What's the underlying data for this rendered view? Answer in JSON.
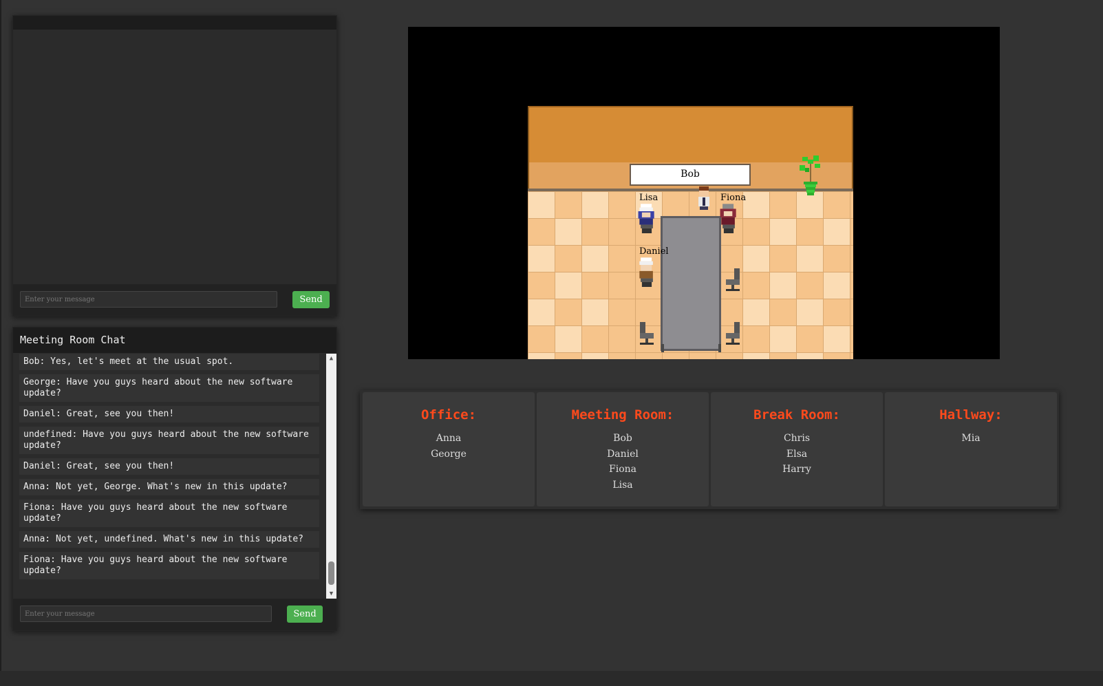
{
  "top_chat": {
    "title": "",
    "input_placeholder": "Enter your message",
    "send_label": "Send"
  },
  "meeting_chat": {
    "title": "Meeting Room Chat",
    "input_placeholder": "Enter your message",
    "send_label": "Send",
    "messages": [
      "Bob: Yes, let's meet at the usual spot.",
      "George: Have you guys heard about the new software update?",
      "Daniel: Great, see you then!",
      "undefined: Have you guys heard about the new software update?",
      "Daniel: Great, see you then!",
      "Anna: Not yet, George. What's new in this update?",
      "Fiona: Have you guys heard about the new software update?",
      "Anna: Not yet, undefined. What's new in this update?",
      "Fiona: Have you guys heard about the new software update?"
    ]
  },
  "game": {
    "nameplate": "Bob",
    "characters": {
      "lisa": "Lisa",
      "fiona": "Fiona",
      "daniel": "Daniel"
    }
  },
  "rooms": [
    {
      "title": "Office:",
      "people": [
        "Anna",
        "George"
      ]
    },
    {
      "title": "Meeting Room:",
      "people": [
        "Bob",
        "Daniel",
        "Fiona",
        "Lisa"
      ]
    },
    {
      "title": "Break Room:",
      "people": [
        "Chris",
        "Elsa",
        "Harry"
      ]
    },
    {
      "title": "Hallway:",
      "people": [
        "Mia"
      ]
    }
  ],
  "colors": {
    "send_button": "#4caf50",
    "room_title": "#ff4a1c",
    "background": "#333333"
  }
}
